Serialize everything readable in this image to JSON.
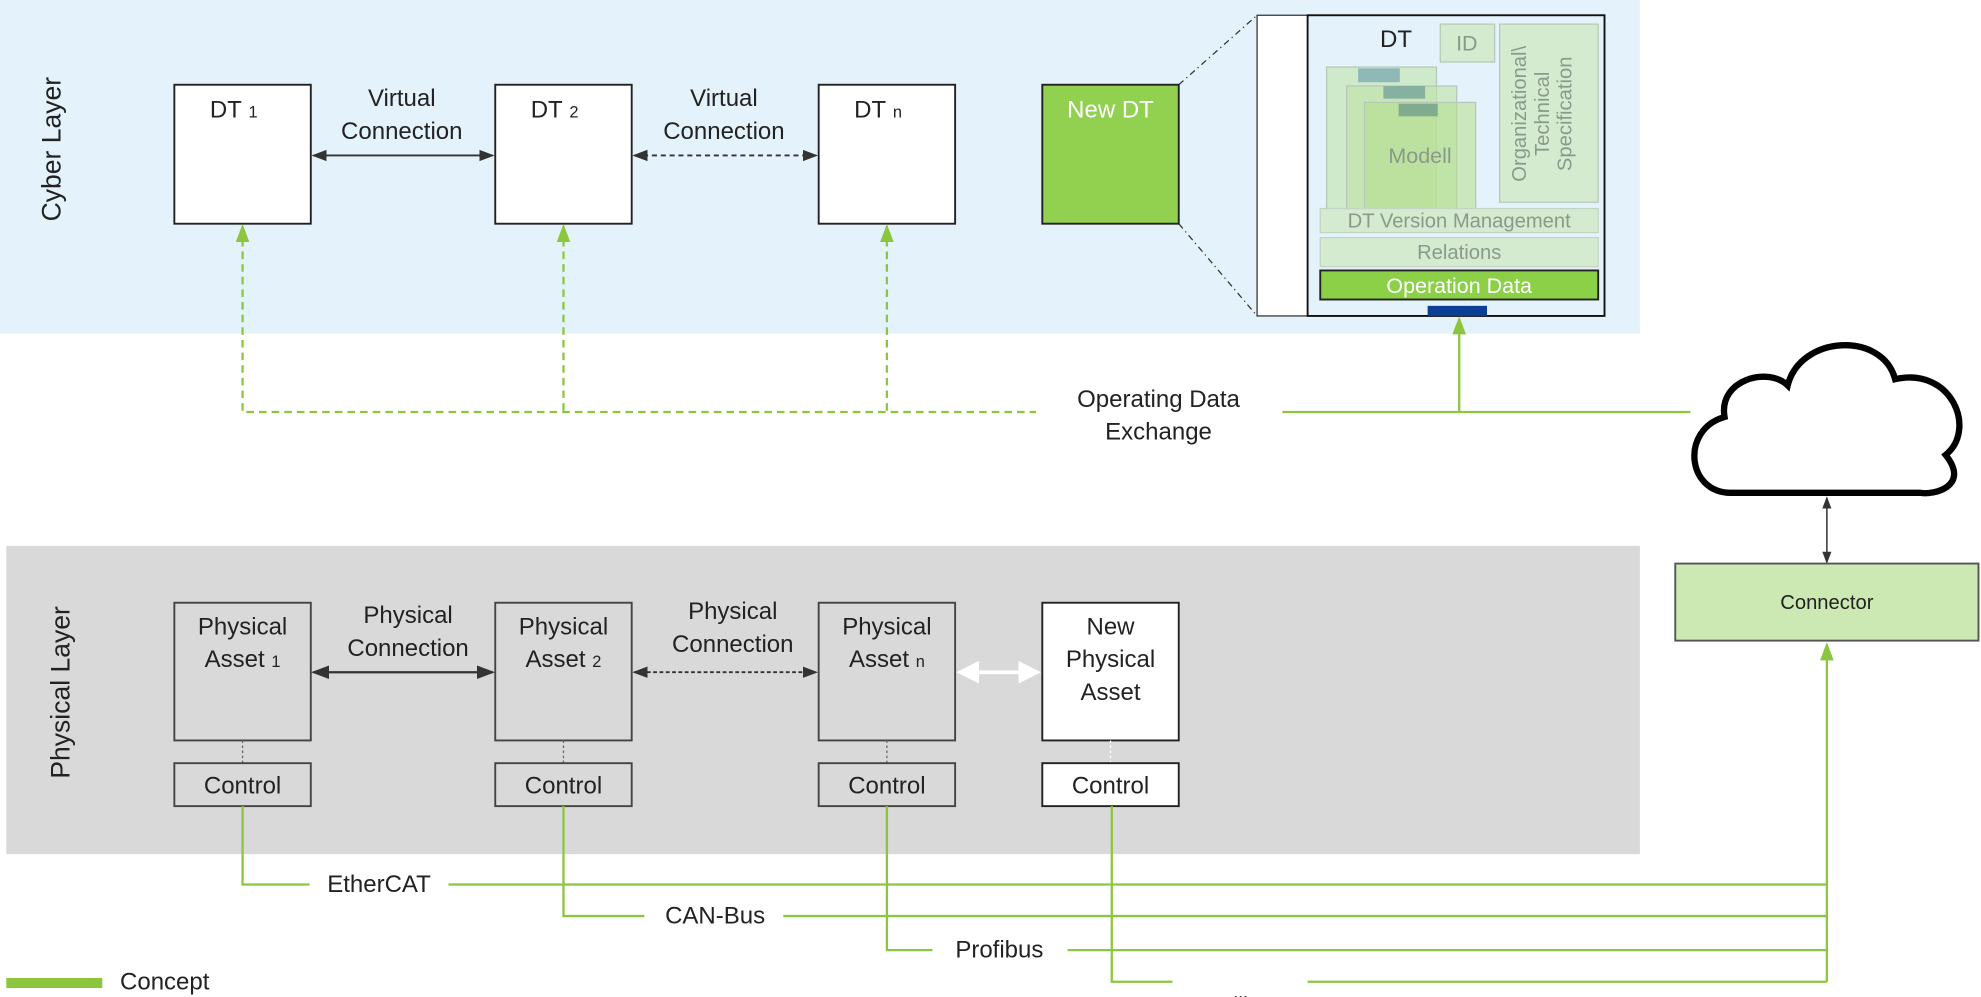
{
  "colors": {
    "cyber_bg": "#e4f2fb",
    "physical_bg": "#d9d9d9",
    "concept_green": "#8cc63f",
    "new_dt": "#92d050",
    "connector": "#cde9b3",
    "blue_port": "#0b3f94"
  },
  "cyber": {
    "label": "Cyber Layer",
    "dts": [
      {
        "name": "DT",
        "sub": "1"
      },
      {
        "name": "DT",
        "sub": "2"
      },
      {
        "name": "DT",
        "sub": "n"
      }
    ],
    "virtual_connection": [
      "Virtual",
      "Connection"
    ],
    "new_dt": "New DT",
    "detail": {
      "title": "DT",
      "id": "ID",
      "spec": [
        "Organizational\\",
        "Technical",
        "Specification"
      ],
      "model": "Modell",
      "version": "DT Version Management",
      "relations": "Relations",
      "operation": "Operation Data"
    }
  },
  "exchange": [
    "Operating Data",
    "Exchange"
  ],
  "connector": "Connector",
  "physical": {
    "label": "Physical Layer",
    "assets": [
      {
        "l1": "Physical",
        "l2": "Asset",
        "sub": "1"
      },
      {
        "l1": "Physical",
        "l2": "Asset",
        "sub": "2"
      },
      {
        "l1": "Physical",
        "l2": "Asset",
        "sub": "n"
      }
    ],
    "new_asset": [
      "New",
      "Physical",
      "Asset"
    ],
    "physical_connection": [
      "Physical",
      "Connection"
    ],
    "control": "Control"
  },
  "buses": [
    "EtherCAT",
    "CAN-Bus",
    "Profibus",
    "..."
  ],
  "legend": {
    "label": "Concept"
  }
}
